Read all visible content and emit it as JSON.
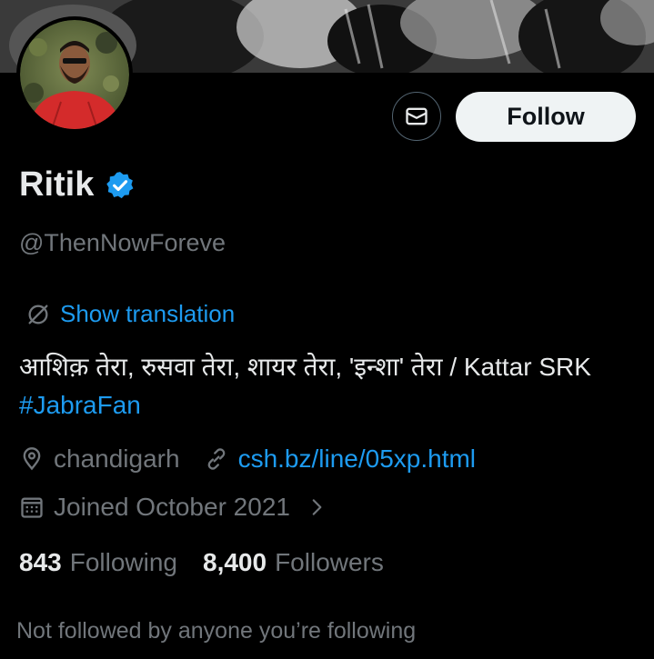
{
  "profile": {
    "name": "Ritik",
    "handle": "@ThenNowForeve",
    "follow_label": "Follow",
    "verified": true,
    "show_translation": "Show translation",
    "bio_text": "आशिक़ तेरा, रुसवा तेरा, शायर तेरा, 'इन्शा' तेरा / Kattar SRK ",
    "bio_hashtag": "#JabraFan",
    "location": "chandigarh",
    "website": "csh.bz/line/05xp.html",
    "joined": "Joined October 2021",
    "following_count": "843",
    "following_label": "Following",
    "followers_count": "8,400",
    "followers_label": "Followers",
    "not_followed_note": "Not followed by anyone you’re following"
  },
  "colors": {
    "background": "#000000",
    "accent": "#1d9bf0",
    "muted": "#71767b",
    "text": "#e7e9ea"
  },
  "icons": [
    "message-icon",
    "verified-badge-icon",
    "translate-icon",
    "location-pin-icon",
    "link-icon",
    "calendar-icon",
    "chevron-right-icon"
  ]
}
